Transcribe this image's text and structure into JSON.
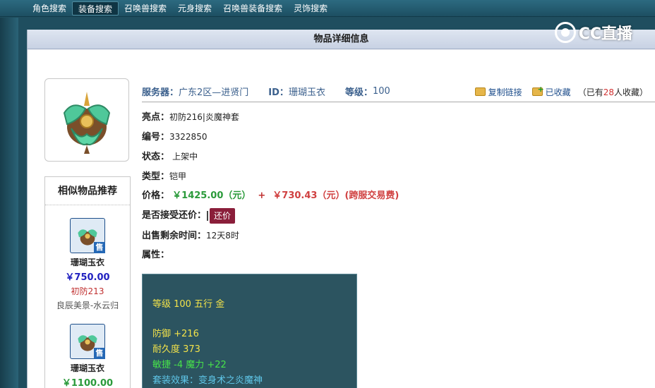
{
  "nav": {
    "tabs": [
      {
        "label": "角色搜索",
        "active": false
      },
      {
        "label": "装备搜索",
        "active": true
      },
      {
        "label": "召唤兽搜索",
        "active": false
      },
      {
        "label": "元身搜索",
        "active": false
      },
      {
        "label": "召唤兽装备搜索",
        "active": false
      },
      {
        "label": "灵饰搜索",
        "active": false
      }
    ]
  },
  "watermark": "CC直播",
  "panel": {
    "title": "物品详细信息"
  },
  "header": {
    "server_label": "服务器：",
    "server_value": "广东2区—进贤门",
    "id_label": "ID：",
    "id_value": "珊瑚玉衣",
    "level_label": "等级：",
    "level_value": "100",
    "copy_link": "复制链接",
    "favorited": "已收藏",
    "fav_prefix": "（已有",
    "fav_count": "28",
    "fav_suffix": "人收藏）"
  },
  "details": {
    "highlight_label": "亮点：",
    "highlight_value1": "初防216",
    "highlight_sep": "|",
    "highlight_value2": "炎魔神套",
    "serial_label": "编号：",
    "serial_value": "3322850",
    "status_label": "状态：",
    "status_value": "上架中",
    "type_label": "类型：",
    "type_value": "铠甲",
    "price_label": "价格：",
    "price_value": "￥1425.00（元）",
    "price_plus": "+",
    "price_fee": "￥730.43（元）(跨服交易费)",
    "counter_label": "是否接受还价：",
    "counter_button": "还价",
    "remaining_label": "出售剩余时间：",
    "remaining_value": "12天8时",
    "attr_label": "属性："
  },
  "attributes": {
    "line1": "等级 100  五行 金",
    "defense": "防御 +216",
    "durability": "耐久度 373",
    "agility_magic": "敏捷 -4  魔力 +22",
    "set_effect": "套装效果：变身术之炎魔神"
  },
  "similar": {
    "title": "相似物品推荐",
    "badge": "售",
    "items": [
      {
        "name": "珊瑚玉衣",
        "price": "￥750.00",
        "highlight": "初防213",
        "server": "良辰美景-水云归"
      },
      {
        "name": "珊瑚玉衣",
        "price": "￥1100.00"
      }
    ]
  },
  "colors": {
    "nav_bg": "#2c6a80",
    "attr_bg": "#2c5460",
    "counter_btn": "#8a1e3a",
    "price_green": "#2a9a3a",
    "price_red": "#d04040",
    "attr_yellow": "#f2e24a",
    "attr_green": "#47e24a",
    "attr_cyan": "#5fc6e8"
  }
}
